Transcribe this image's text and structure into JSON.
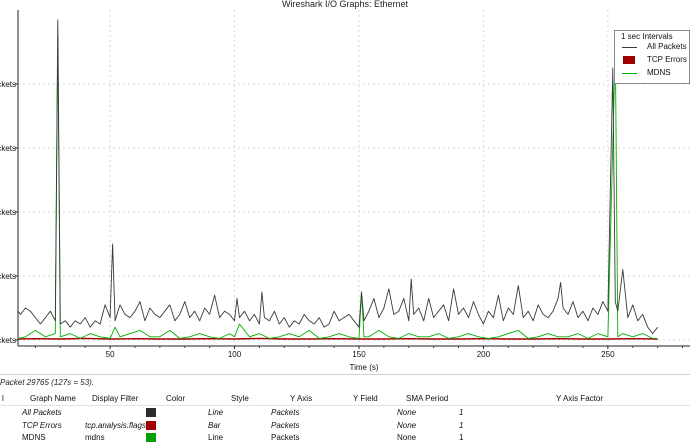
{
  "window": {
    "title": "Wireshark I/O Graphs: Ethernet"
  },
  "legend": {
    "title": "1 sec Intervals",
    "items": [
      {
        "label": "All Packets",
        "color": "#3a3a3a",
        "style": "line"
      },
      {
        "label": "TCP Errors",
        "color": "#a00000",
        "style": "bar"
      },
      {
        "label": "MDNS",
        "color": "#00b000",
        "style": "line"
      }
    ]
  },
  "chart_data": {
    "type": "line",
    "xlabel": "Time (s)",
    "ylabel": "",
    "xlim": [
      13,
      283
    ],
    "ylim": [
      0,
      100
    ],
    "x_ticks": [
      50,
      100,
      150,
      200,
      250
    ],
    "y_tick_values": [
      0,
      20,
      40,
      60,
      80
    ],
    "y_tick_labels": [
      "Packets",
      "Packets",
      "Packets",
      "Packets",
      "Packets"
    ],
    "grid": true,
    "legend_position": "top-right",
    "series": [
      {
        "name": "All Packets",
        "color": "#3a3a3a",
        "x": [
          13,
          14,
          16,
          18,
          20,
          22,
          24,
          26,
          28,
          29,
          30,
          32,
          34,
          36,
          38,
          40,
          42,
          44,
          46,
          48,
          50,
          51,
          52,
          54,
          56,
          58,
          60,
          62,
          64,
          66,
          68,
          70,
          72,
          74,
          76,
          78,
          80,
          82,
          84,
          86,
          88,
          90,
          92,
          94,
          96,
          98,
          100,
          101,
          102,
          104,
          106,
          108,
          110,
          111,
          112,
          114,
          116,
          118,
          120,
          122,
          124,
          126,
          128,
          130,
          132,
          134,
          136,
          138,
          140,
          142,
          144,
          146,
          148,
          150,
          151,
          152,
          154,
          156,
          158,
          160,
          162,
          164,
          166,
          168,
          170,
          171,
          172,
          174,
          176,
          178,
          180,
          182,
          184,
          186,
          188,
          190,
          192,
          194,
          196,
          198,
          200,
          202,
          204,
          206,
          208,
          210,
          212,
          214,
          216,
          218,
          220,
          222,
          224,
          226,
          228,
          230,
          231,
          232,
          234,
          236,
          238,
          240,
          242,
          244,
          246,
          248,
          250,
          252,
          253,
          254,
          256,
          258,
          260,
          262,
          264,
          266,
          268,
          270
        ],
        "y": [
          9,
          8,
          10,
          9,
          7,
          5,
          7,
          9,
          6,
          100,
          5,
          6,
          4,
          6,
          5,
          7,
          4,
          6,
          5,
          11,
          7,
          30,
          6,
          11,
          8,
          7,
          9,
          12,
          6,
          10,
          8,
          7,
          9,
          11,
          6,
          8,
          12,
          7,
          9,
          6,
          10,
          8,
          14,
          7,
          9,
          8,
          6,
          13,
          7,
          9,
          6,
          8,
          5,
          15,
          7,
          6,
          9,
          5,
          7,
          4,
          6,
          5,
          8,
          6,
          5,
          7,
          4,
          5,
          9,
          6,
          7,
          8,
          6,
          4,
          15,
          6,
          9,
          13,
          7,
          10,
          16,
          8,
          9,
          13,
          6,
          19,
          8,
          10,
          6,
          13,
          7,
          9,
          11,
          6,
          16,
          8,
          10,
          7,
          12,
          8,
          5,
          9,
          7,
          14,
          6,
          10,
          8,
          17,
          7,
          9,
          6,
          11,
          8,
          7,
          9,
          13,
          18,
          10,
          8,
          12,
          7,
          9,
          6,
          10,
          8,
          12,
          9,
          85,
          12,
          9,
          22,
          7,
          11,
          6,
          8,
          4,
          2,
          4
        ]
      },
      {
        "name": "TCP Errors",
        "color": "#a00000",
        "x": [
          13,
          20,
          30,
          40,
          50,
          60,
          70,
          80,
          90,
          100,
          110,
          120,
          130,
          140,
          150,
          160,
          170,
          180,
          190,
          200,
          210,
          220,
          230,
          240,
          250,
          260,
          270
        ],
        "y": [
          0.3,
          0.4,
          0.3,
          0.5,
          0.3,
          0.4,
          0.3,
          0.3,
          0.4,
          0.3,
          0.5,
          0.3,
          0.3,
          0.4,
          0.3,
          0.3,
          0.4,
          0.3,
          0.3,
          0.4,
          0.3,
          0.3,
          0.4,
          0.3,
          0.3,
          0.4,
          0.3
        ]
      },
      {
        "name": "MDNS",
        "color": "#00b000",
        "x": [
          13,
          16,
          20,
          24,
          28,
          29,
          30,
          34,
          38,
          42,
          46,
          50,
          52,
          54,
          58,
          62,
          66,
          70,
          74,
          78,
          82,
          86,
          90,
          94,
          98,
          100,
          102,
          106,
          110,
          114,
          118,
          122,
          126,
          130,
          134,
          138,
          142,
          146,
          150,
          151,
          152,
          154,
          158,
          162,
          166,
          170,
          174,
          178,
          182,
          186,
          190,
          194,
          198,
          202,
          206,
          210,
          214,
          218,
          222,
          226,
          230,
          234,
          238,
          242,
          246,
          250,
          253,
          254,
          256,
          260,
          264,
          268,
          270
        ],
        "y": [
          0.5,
          1,
          3,
          1,
          2,
          95,
          1,
          2,
          0.5,
          2,
          1,
          0.5,
          4,
          1,
          2,
          3,
          1,
          1,
          3,
          0.5,
          1,
          2,
          1,
          0.5,
          2,
          1,
          5,
          1,
          2,
          0.5,
          1,
          2,
          1,
          3,
          0.5,
          1,
          2,
          1,
          0.5,
          15,
          1,
          1,
          3,
          1,
          0.5,
          2,
          1,
          1,
          2,
          0.5,
          1,
          2,
          1,
          0.5,
          1,
          2,
          3,
          0.5,
          1,
          2,
          1,
          1,
          2,
          0.5,
          2,
          1,
          92,
          1,
          2,
          1,
          2,
          0.5,
          0.5
        ]
      }
    ]
  },
  "status": {
    "text": "Packet 29765 (127s = 53)."
  },
  "table": {
    "columns": [
      "Graph Name",
      "Display Filter",
      "Color",
      "Style",
      "Y Axis",
      "Y Field",
      "SMA Period",
      "Y Axis Factor"
    ],
    "rows": [
      {
        "name": "All Packets",
        "filter": "",
        "color": "#2c2c2c",
        "style": "Line",
        "y_axis": "Packets",
        "y_field": "",
        "sma": "None",
        "factor": "1",
        "italic": true
      },
      {
        "name": "TCP Errors",
        "filter": "tcp.analysis.flags",
        "color": "#a00000",
        "style": "Bar",
        "y_axis": "Packets",
        "y_field": "",
        "sma": "None",
        "factor": "1",
        "italic": true
      },
      {
        "name": "MDNS",
        "filter": "mdns",
        "color": "#00a000",
        "style": "Line",
        "y_axis": "Packets",
        "y_field": "",
        "sma": "None",
        "factor": "1",
        "italic": false
      }
    ]
  }
}
